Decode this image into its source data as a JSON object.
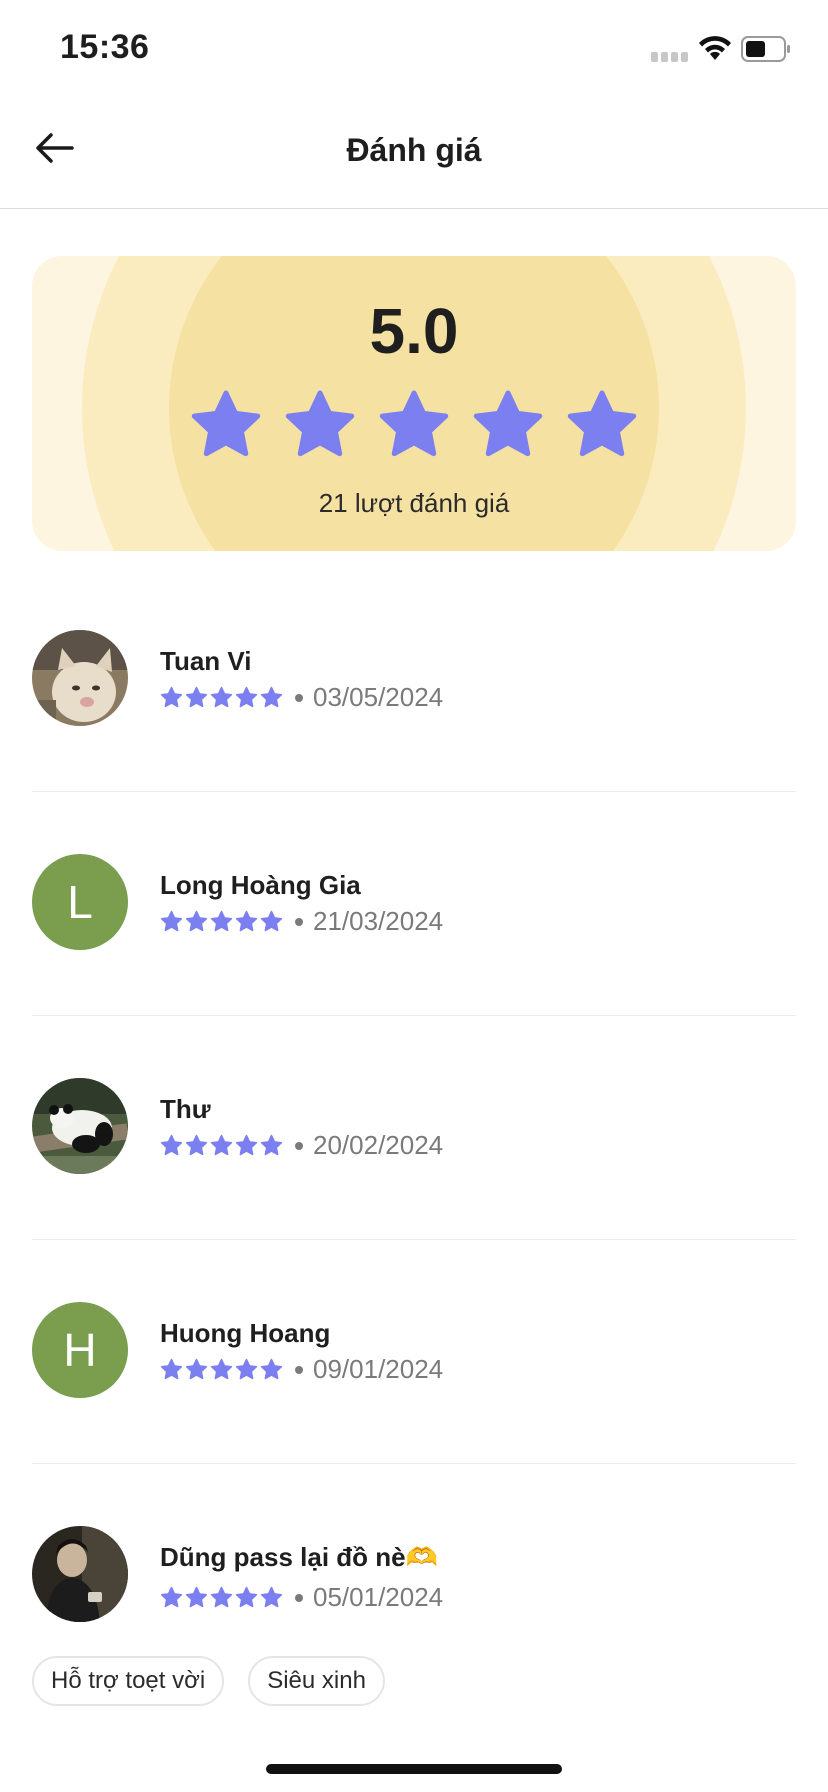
{
  "status_bar": {
    "time": "15:36"
  },
  "header": {
    "title": "Đánh giá"
  },
  "rating_summary": {
    "score": "5.0",
    "stars": 5,
    "count_label": "21 lượt đánh giá",
    "star_color": "#7b7ff0"
  },
  "reviews": [
    {
      "name": "Tuan Vi",
      "stars": 5,
      "date": "03/05/2024",
      "avatar": "photo-cat"
    },
    {
      "name": "Long Hoàng Gia",
      "stars": 5,
      "date": "21/03/2024",
      "avatar_letter": "L"
    },
    {
      "name": "Thư",
      "stars": 5,
      "date": "20/02/2024",
      "avatar": "photo-panda"
    },
    {
      "name": "Huong Hoang",
      "stars": 5,
      "date": "09/01/2024",
      "avatar_letter": "H"
    },
    {
      "name": "Dũng pass lại đồ nè🫶",
      "stars": 5,
      "date": "05/01/2024",
      "avatar": "photo-person"
    }
  ],
  "tags": [
    "Hỗ trợ toẹt vời",
    "Siêu xinh"
  ]
}
